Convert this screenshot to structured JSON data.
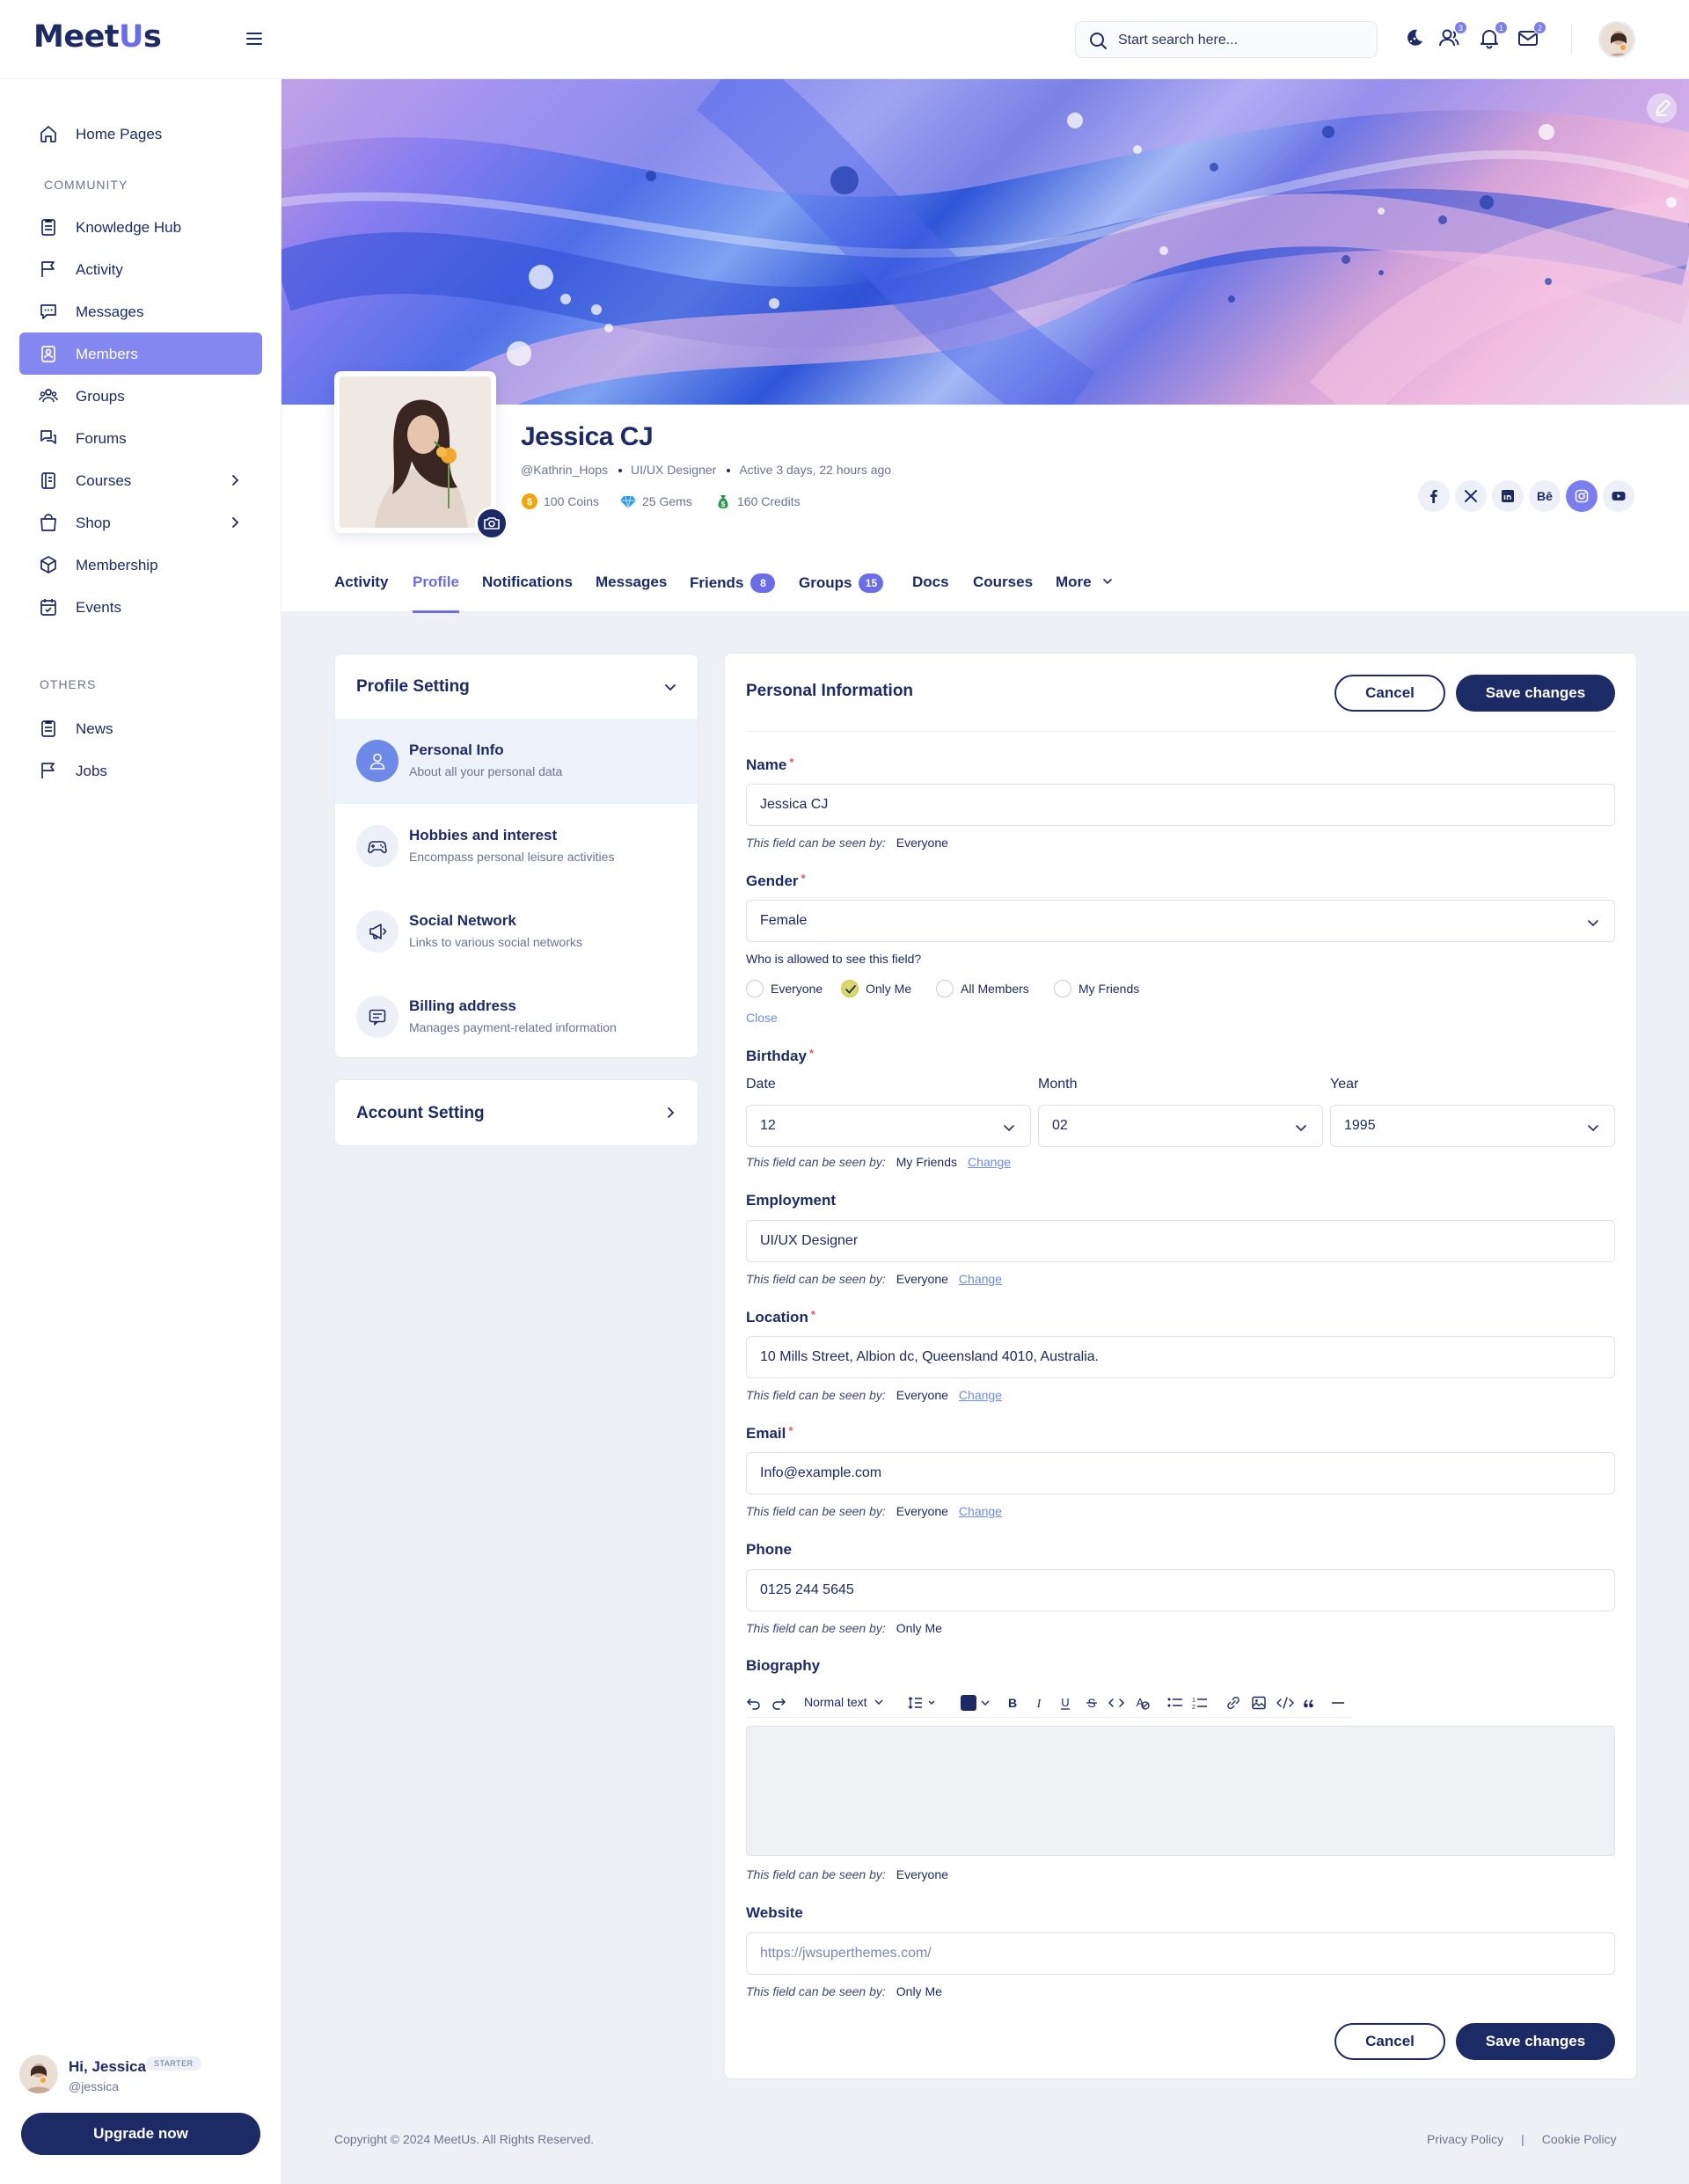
{
  "brand": {
    "logo_left": "Meet",
    "logo_u": "U",
    "logo_right": "s"
  },
  "search": {
    "placeholder": "Start search here..."
  },
  "topbar": {
    "friends_count": "3",
    "notifications_count": "1",
    "messages_count": "2"
  },
  "sidebar": {
    "home": "Home Pages",
    "community_label": "COMMUNITY",
    "items": [
      {
        "label": "Knowledge Hub"
      },
      {
        "label": "Activity"
      },
      {
        "label": "Messages"
      },
      {
        "label": "Members"
      },
      {
        "label": "Groups"
      },
      {
        "label": "Forums"
      },
      {
        "label": "Courses"
      },
      {
        "label": "Shop"
      },
      {
        "label": "Membership"
      },
      {
        "label": "Events"
      }
    ],
    "others_label": "OTHERS",
    "others": [
      {
        "label": "News"
      },
      {
        "label": "Jobs"
      }
    ],
    "active_item": "Members"
  },
  "user": {
    "greeting": "Hi, Jessica",
    "plan": "STARTER",
    "handle": "@jessica",
    "upgrade": "Upgrade now"
  },
  "profile": {
    "name": "Jessica CJ",
    "username": "@Kathrin_Hops",
    "role": "UI/UX Designer",
    "active": "Active 3 days, 22 hours ago",
    "coins": "100 Coins",
    "gems": "25 Gems",
    "credits": "160 Credits",
    "behance_label": "Bē"
  },
  "tabs": {
    "activity": "Activity",
    "profile": "Profile",
    "notifications": "Notifications",
    "messages": "Messages",
    "friends": "Friends",
    "friends_count": "8",
    "groups": "Groups",
    "groups_count": "15",
    "docs": "Docs",
    "courses": "Courses",
    "more": "More",
    "active": "Profile"
  },
  "profile_setting": {
    "title": "Profile Setting",
    "items": [
      {
        "title": "Personal Info",
        "subtitle": "About all your personal data"
      },
      {
        "title": "Hobbies and interest",
        "subtitle": "Encompass personal leisure activities"
      },
      {
        "title": "Social Network",
        "subtitle": "Links to various social networks"
      },
      {
        "title": "Billing address",
        "subtitle": "Manages payment-related information"
      }
    ],
    "active_item": "Personal Info"
  },
  "account_setting": {
    "title": "Account Setting"
  },
  "form": {
    "title": "Personal Information",
    "cancel": "Cancel",
    "save": "Save changes",
    "seen_prefix": "This field can be seen by:",
    "change": "Change",
    "name": {
      "label": "Name",
      "value": "Jessica CJ",
      "seen": "Everyone"
    },
    "gender": {
      "label": "Gender",
      "value": "Female",
      "who_label": "Who is allowed to see this field?",
      "options": [
        "Everyone",
        "Only Me",
        "All Members",
        "My Friends"
      ],
      "selected": "Only Me",
      "close": "Close"
    },
    "birthday": {
      "label": "Birthday",
      "date_label": "Date",
      "date": "12",
      "month_label": "Month",
      "month": "02",
      "year_label": "Year",
      "year": "1995",
      "seen": "My Friends"
    },
    "employment": {
      "label": "Employment",
      "value": "UI/UX Designer",
      "seen": "Everyone"
    },
    "location": {
      "label": "Location",
      "value": "10 Mills Street, Albion dc, Queensland 4010, Australia.",
      "seen": "Everyone"
    },
    "email": {
      "label": "Email",
      "value": "Info@example.com",
      "seen": "Everyone"
    },
    "phone": {
      "label": "Phone",
      "value": "0125 244 5645",
      "seen": "Only Me"
    },
    "biography": {
      "label": "Biography",
      "text_style": "Normal text",
      "seen": "Everyone",
      "color": "#1c2a66"
    },
    "website": {
      "label": "Website",
      "placeholder": "https://jwsuperthemes.com/",
      "seen": "Only Me"
    }
  },
  "footer": {
    "copyright": "Copyright © 2024 MeetUs. All Rights Reserved.",
    "privacy": "Privacy Policy",
    "separator": "|",
    "cookie": "Cookie Policy"
  },
  "colors": {
    "primary": "#1c2a66",
    "accent": "#6b6de8",
    "active_nav": "#8587f0",
    "link": "#6d8ae9"
  }
}
